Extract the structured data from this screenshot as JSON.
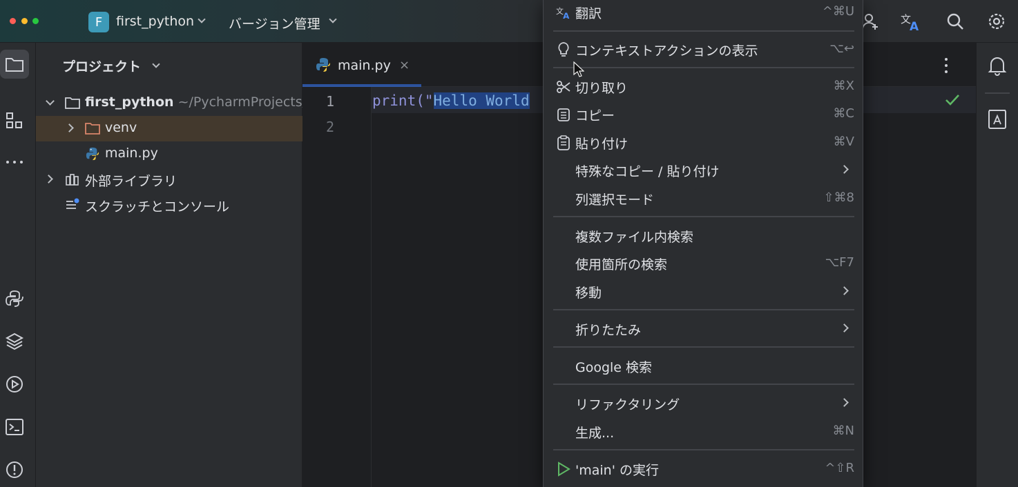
{
  "titlebar": {
    "project_badge": "F",
    "project_name": "first_python",
    "vcs_label": "バージョン管理",
    "icons": [
      "add-user-icon",
      "translate-icon",
      "search-icon",
      "gear-icon"
    ]
  },
  "toolstrip": {
    "icons": [
      "project-folder-icon",
      "structure-icon",
      "more-icon",
      "python-console-icon",
      "layers-icon",
      "run-icon",
      "terminal-icon",
      "problems-icon"
    ]
  },
  "project_panel": {
    "title": "プロジェクト",
    "tree": [
      {
        "label": "first_python",
        "path": "~/PycharmProjects/fi",
        "icon": "folder-icon",
        "expanded": true
      },
      {
        "label": "venv",
        "icon": "folder-icon",
        "expanded": false,
        "selected": true
      },
      {
        "label": "main.py",
        "icon": "python-file-icon"
      },
      {
        "label": "外部ライブラリ",
        "icon": "library-icon",
        "expanded": false
      },
      {
        "label": "スクラッチとコンソール",
        "icon": "scratch-icon"
      }
    ]
  },
  "editor": {
    "tab_label": "main.py",
    "tab_close": "×",
    "line_numbers": [
      "1",
      "2"
    ],
    "code": {
      "fn": "print(\"",
      "selected": "Hello World"
    }
  },
  "context_menu": {
    "items": [
      {
        "label": "翻訳",
        "shortcut": "^⌘U",
        "icon": "translate-icon"
      },
      {
        "label": "コンテキストアクションの表示",
        "shortcut": "⌥↩",
        "icon": "lightbulb-icon"
      },
      {
        "label": "切り取り",
        "shortcut": "⌘X",
        "icon": "scissors-icon"
      },
      {
        "label": "コピー",
        "shortcut": "⌘C",
        "icon": "copy-icon"
      },
      {
        "label": "貼り付け",
        "shortcut": "⌘V",
        "icon": "paste-icon"
      },
      {
        "label": "特殊なコピー / 貼り付け",
        "submenu": true
      },
      {
        "label": "列選択モード",
        "shortcut": "⇧⌘8"
      },
      {
        "label": "複数ファイル内検索"
      },
      {
        "label": "使用箇所の検索",
        "shortcut": "⌥F7"
      },
      {
        "label": "移動",
        "submenu": true
      },
      {
        "label": "折りたたみ",
        "submenu": true
      },
      {
        "label": "Google 検索"
      },
      {
        "label": "リファクタリング",
        "submenu": true
      },
      {
        "label": "生成...",
        "shortcut": "⌘N"
      },
      {
        "label": "'main' の実行",
        "shortcut": "^⇧R",
        "icon": "run-icon"
      }
    ]
  },
  "colors": {
    "accent": "#3574f0",
    "run_green": "#5fb865",
    "selection": "#214283",
    "string": "#6aab73",
    "function": "#8f92da"
  }
}
